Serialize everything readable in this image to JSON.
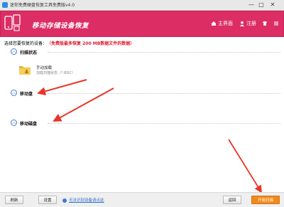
{
  "window": {
    "title": "迷你免费硬盘恢复工具免费版v4.0",
    "controls": [
      "—",
      "□",
      "✕"
    ]
  },
  "header": {
    "banner": "移动存储设备恢复",
    "home_label": "主界面",
    "register_label": "注册",
    "accent_color": "#dc2d64"
  },
  "prompt": {
    "text": "选择您要恢复的设备：",
    "highlight": "（免费版最多恢复 200 MB数据文件的数据）"
  },
  "sections": {
    "scan_status": "扫描状态",
    "mobile_disk": "移动盘",
    "removable_disk": "移动磁盘"
  },
  "scan_item": {
    "name": "手动加载",
    "status": "加载扫描状态（*.BDC）"
  },
  "footer": {
    "refresh": "刷新",
    "settings": "设置",
    "help_link": "无法识别设备请点此",
    "back": "返回",
    "start_scan": "开始扫描"
  }
}
